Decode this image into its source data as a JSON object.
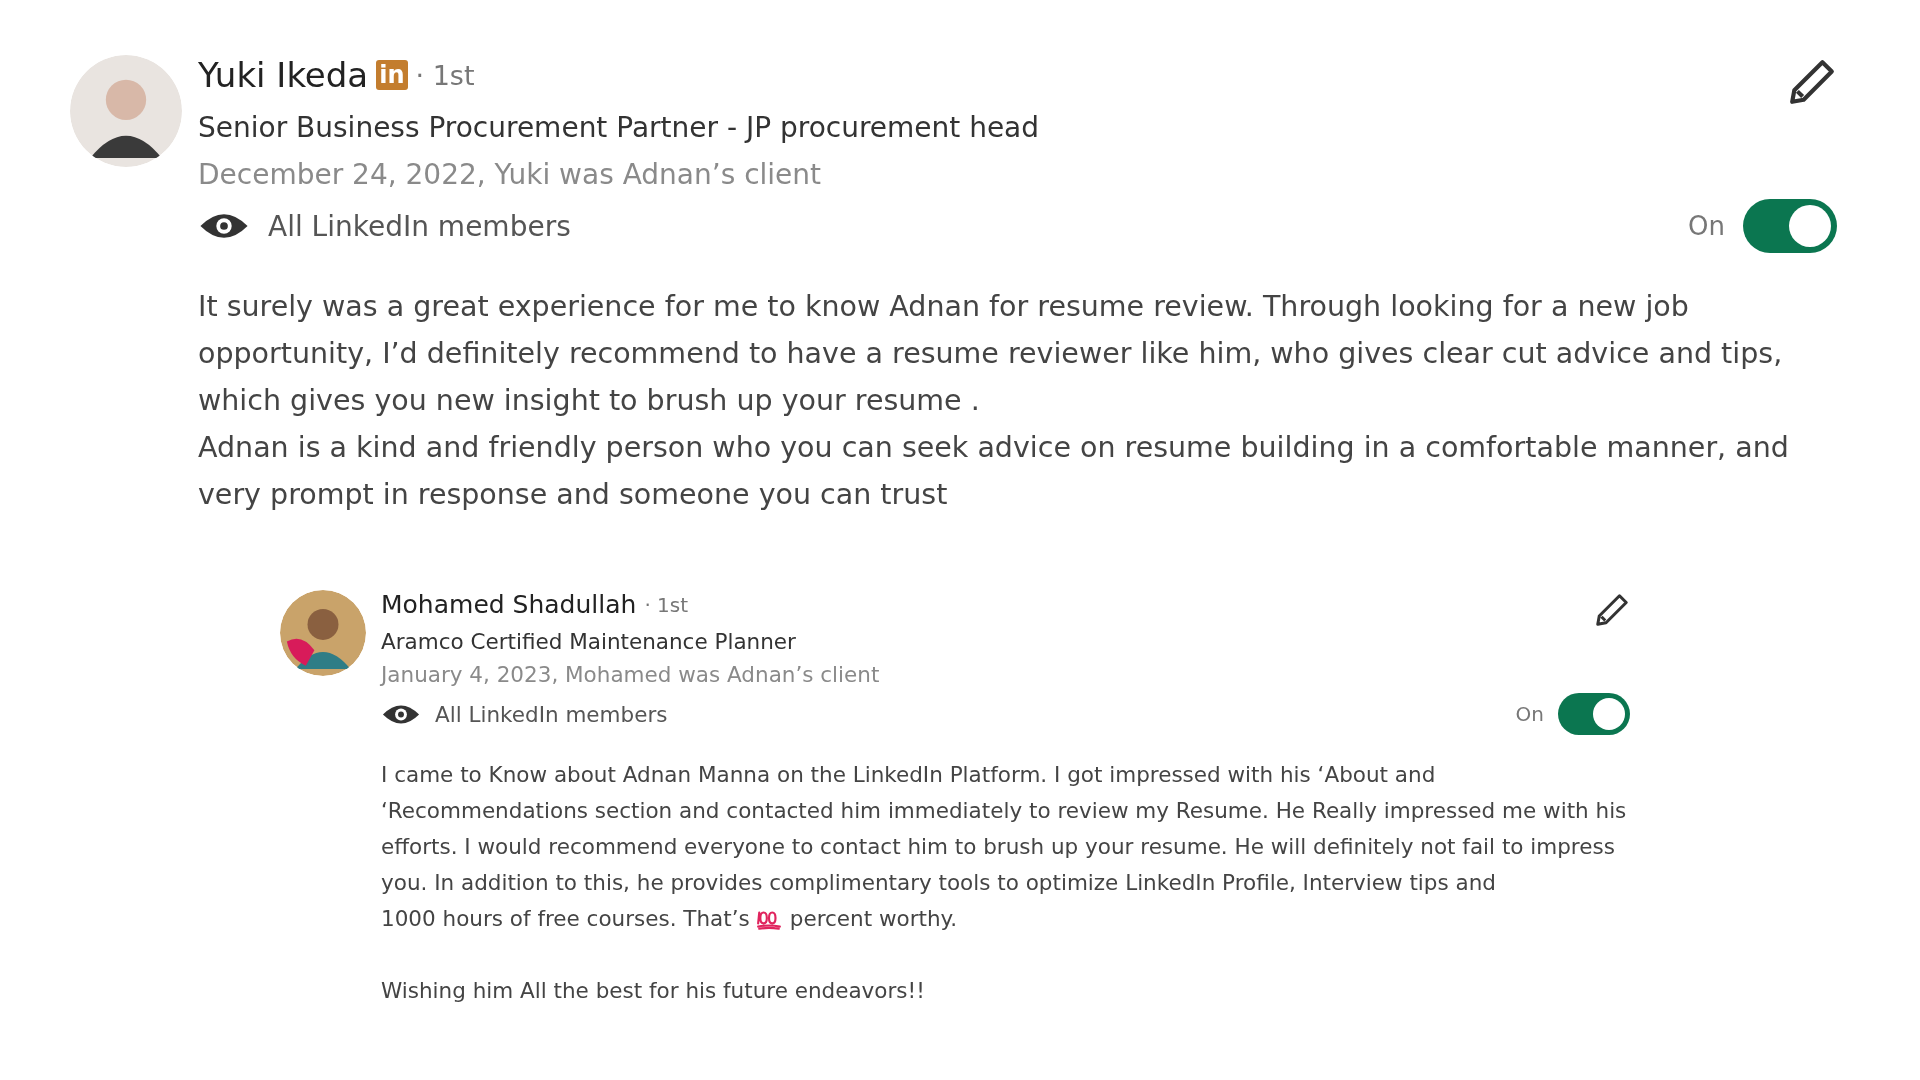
{
  "recommendations": [
    {
      "name": "Yuki Ikeda",
      "badge": "in",
      "degree": "· 1st",
      "headline": "Senior Business Procurement Partner - JP procurement head",
      "relation": "December 24, 2022, Yuki was Adnan’s client",
      "visibility": "All LinkedIn members",
      "toggle_label": "On",
      "on": true,
      "paragraphs": [
        {
          "parts": [
            {
              "kind": "text",
              "text": "It surely was a great experience for me to know Adnan for resume review. Through looking for a new job opportunity, I’d definitely recommend to have a resume reviewer like him, who gives clear cut advice and tips, which gives you new insight to brush up your resume ."
            }
          ]
        },
        {
          "parts": [
            {
              "kind": "text",
              "text": "Adnan is a kind and friendly person who you can seek advice on resume building in a comfortable manner, and very prompt in response and someone you can trust"
            }
          ]
        }
      ],
      "children": [
        {
          "name": "Mohamed Shadullah",
          "degree": "· 1st",
          "headline": "Aramco Certified Maintenance Planner",
          "relation": "January 4, 2023, Mohamed was Adnan’s client",
          "visibility": "All LinkedIn members",
          "toggle_label": "On",
          "on": true,
          "paragraphs": [
            {
              "parts": [
                {
                  "kind": "text",
                  "text": "I came to Know about Adnan Manna on the LinkedIn Platform. I got impressed with his ‘About and ‘Recommendations section and contacted him immediately to review my Resume. He Really impressed me with his efforts. I would recommend everyone to contact him to brush up your resume. He will definitely not fail to impress you. In addition to this, he provides complimentary tools to optimize LinkedIn Profile, Interview tips and"
                },
                {
                  "kind": "text",
                  "text": "1000 hours of free courses. That’s"
                },
                {
                  "kind": "hundred"
                },
                {
                  "kind": "text",
                  "text": "percent worthy."
                }
              ]
            },
            {
              "parts": [
                {
                  "kind": "text",
                  "text": "Wishing him All the best for his future endeavors!!"
                }
              ]
            }
          ]
        }
      ]
    }
  ]
}
